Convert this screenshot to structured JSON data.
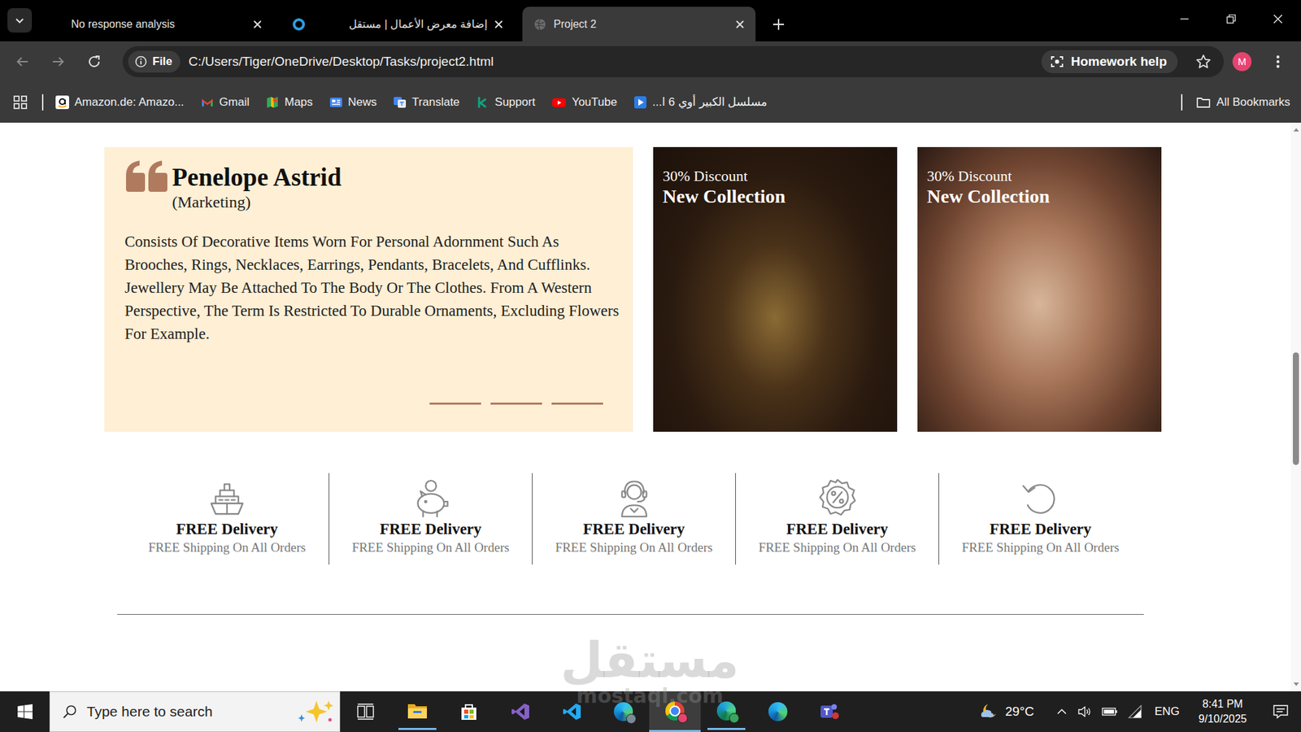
{
  "browser": {
    "tabs": [
      {
        "label": "No response analysis",
        "selected": false,
        "kind": "blank"
      },
      {
        "label": "إضافة معرض الأعمال | مستقل",
        "selected": false,
        "kind": "mostaql"
      },
      {
        "label": "Project 2",
        "selected": true,
        "kind": "globe"
      }
    ],
    "toolbar": {
      "back": {
        "disabled": true
      },
      "forward": {
        "disabled": true
      },
      "address": {
        "chip": "File",
        "url": "C:/Users/Tiger/OneDrive/Desktop/Tasks/project2.html"
      },
      "homework": "Homework help",
      "bookmarked": false,
      "profile": "M"
    },
    "bookmarks": [
      {
        "label": "Amazon.de: Amazo...",
        "kind": "amazon"
      },
      {
        "label": "Gmail",
        "kind": "gmail"
      },
      {
        "label": "Maps",
        "kind": "maps"
      },
      {
        "label": "News",
        "kind": "news"
      },
      {
        "label": "Translate",
        "kind": "translate"
      },
      {
        "label": "Support",
        "kind": "support"
      },
      {
        "label": "YouTube",
        "kind": "youtube"
      },
      {
        "label": "مسلسل الكبير أوي 6 ا...",
        "kind": "video"
      }
    ],
    "all_bookmarks": "All Bookmarks"
  },
  "page": {
    "testimonial": {
      "name": "Penelope Astrid",
      "role": "(Marketing)",
      "text": "Consists Of Decorative Items Worn For Personal Adornment Such As Brooches, Rings, Necklaces, Earrings, Pendants, Bracelets, And Cufflinks. Jewellery May Be Attached To The Body Or The Clothes. From A Western Perspective, The Term Is Restricted To Durable Ornaments, Excluding Flowers For Example.",
      "slides": [
        {
          "selected": false
        },
        {
          "selected": false
        },
        {
          "selected": false
        }
      ]
    },
    "promos": [
      {
        "discount": "30% Discount",
        "title": "New Collection",
        "kind": "necklace-set"
      },
      {
        "discount": "30% Discount",
        "title": "New Collection",
        "kind": "neck-chains"
      }
    ],
    "features": [
      {
        "title": "FREE Delivery",
        "subtitle": "FREE Shipping On All Orders",
        "kind": "ship"
      },
      {
        "title": "FREE Delivery",
        "subtitle": "FREE Shipping On All Orders",
        "kind": "piggy-bank"
      },
      {
        "title": "FREE Delivery",
        "subtitle": "FREE Shipping On All Orders",
        "kind": "support"
      },
      {
        "title": "FREE Delivery",
        "subtitle": "FREE Shipping On All Orders",
        "kind": "discount"
      },
      {
        "title": "FREE Delivery",
        "subtitle": "FREE Shipping On All Orders",
        "kind": "return"
      }
    ]
  },
  "taskbar": {
    "search_placeholder": "Type here to search",
    "apps": [
      {
        "kind": "task-view",
        "running": false,
        "selected": false
      },
      {
        "kind": "explorer",
        "running": true,
        "selected": false
      },
      {
        "kind": "store",
        "running": false,
        "selected": false
      },
      {
        "kind": "visual-studio",
        "running": false,
        "selected": false
      },
      {
        "kind": "vscode",
        "running": false,
        "selected": false
      },
      {
        "kind": "edge-profile",
        "running": false,
        "selected": false
      },
      {
        "kind": "chrome",
        "running": true,
        "selected": true
      },
      {
        "kind": "edge-dev",
        "running": true,
        "selected": false
      },
      {
        "kind": "edge",
        "running": false,
        "selected": false
      },
      {
        "kind": "teams",
        "running": false,
        "selected": false
      }
    ],
    "weather": "29°C",
    "language": "ENG",
    "time": "8:41 PM",
    "date": "9/10/2025"
  },
  "watermark": {
    "arabic": "مستقل",
    "latin": "mostaql.com"
  }
}
